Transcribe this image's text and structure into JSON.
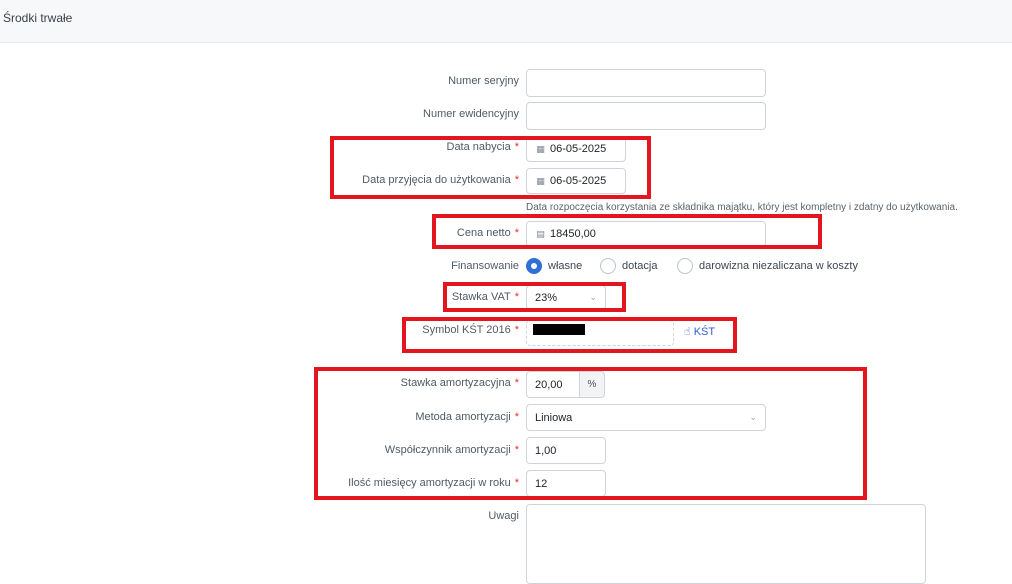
{
  "header": {
    "title": "Środki trwałe"
  },
  "form": {
    "numer_seryjny": {
      "label": "Numer seryjny",
      "value": ""
    },
    "numer_ewidencyjny": {
      "label": "Numer ewidencyjny",
      "value": ""
    },
    "data_nabycia": {
      "label": "Data nabycia",
      "value": "06-05-2025"
    },
    "data_przyjecia": {
      "label": "Data przyjęcia do użytkowania",
      "value": "06-05-2025"
    },
    "hint": "Data rozpoczęcia korzystania ze składnika majątku, który jest kompletny i zdatny do użytkowania.",
    "cena_netto": {
      "label": "Cena netto",
      "value": "18450,00"
    },
    "finansowanie": {
      "label": "Finansowanie",
      "options": [
        "własne",
        "dotacja",
        "darowizna niezaliczana w koszty"
      ],
      "selected": "własne"
    },
    "stawka_vat": {
      "label": "Stawka VAT",
      "value": "23%"
    },
    "symbol_kst": {
      "label": "Symbol KŚT 2016",
      "value": "",
      "link": "KŚT"
    },
    "stawka_amortyzacyjna": {
      "label": "Stawka amortyzacyjna",
      "value": "20,00",
      "unit": "%"
    },
    "metoda_amortyzacji": {
      "label": "Metoda amortyzacji",
      "value": "Liniowa"
    },
    "wspolczynnik": {
      "label": "Współczynnik amortyzacji",
      "value": "1,00"
    },
    "ilosc_miesiecy": {
      "label": "Ilość miesięcy amortyzacji w roku",
      "value": "12"
    },
    "uwagi": {
      "label": "Uwagi",
      "value": ""
    }
  },
  "required_marker": "*",
  "colors": {
    "accent": "#2f6fd6",
    "required": "#e03131",
    "highlight": "#e3151f"
  },
  "icons": {
    "date": "calendar-icon",
    "price": "calculator-icon",
    "kst": "pointer-hand-icon"
  }
}
